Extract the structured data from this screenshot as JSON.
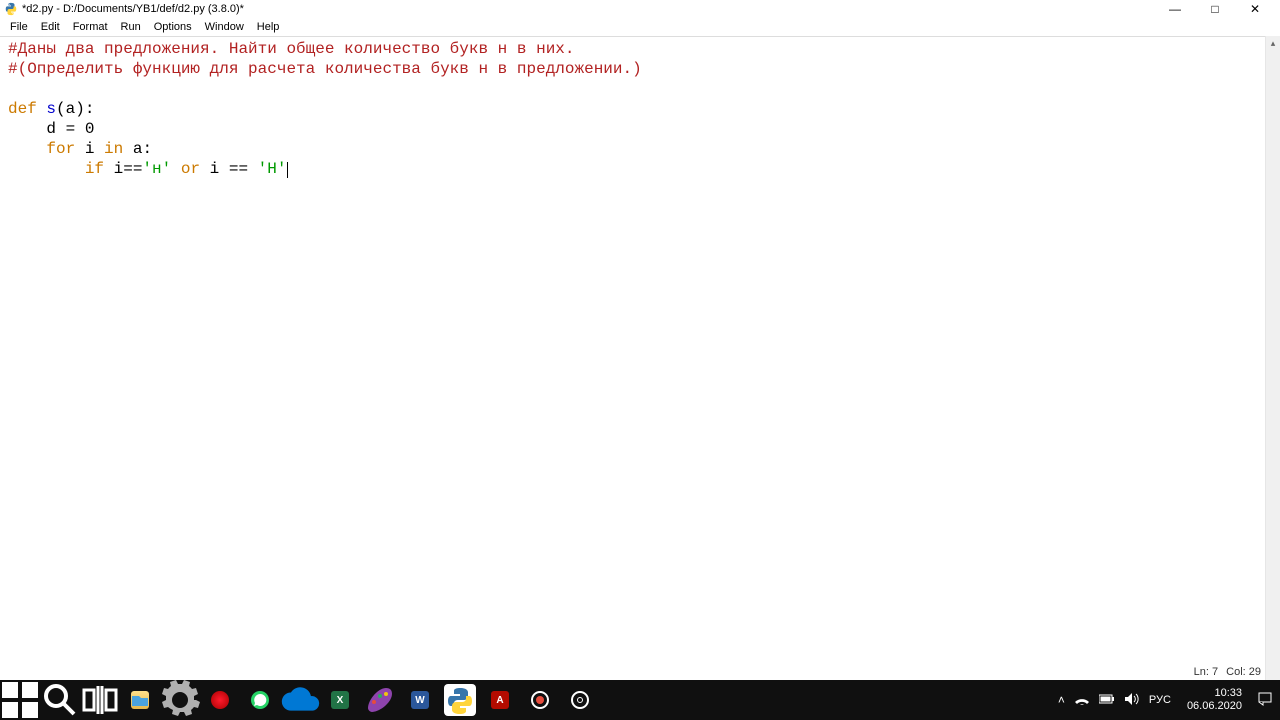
{
  "window": {
    "title": "*d2.py - D:/Documents/YB1/def/d2.py (3.8.0)*"
  },
  "menubar": {
    "items": [
      "File",
      "Edit",
      "Format",
      "Run",
      "Options",
      "Window",
      "Help"
    ]
  },
  "code": {
    "l1": "#Даны два предложения. Найти общее количество букв н в них.",
    "l2": "#(Определить функцию для расчета количества букв н в предложении.)",
    "l3": "",
    "l4_def": "def",
    "l4_name": " s",
    "l4_rest": "(a):",
    "l5": "    d = 0",
    "l6_ind": "    ",
    "l6_for": "for",
    "l6_i": " i ",
    "l6_in": "in",
    "l6_a": " a:",
    "l7_ind": "        ",
    "l7_if": "if",
    "l7_a": " i==",
    "l7_s1": "'н'",
    "l7_b": " ",
    "l7_or": "or",
    "l7_c": " i == ",
    "l7_s2": "'Н'"
  },
  "status": {
    "line": "Ln: 7",
    "col": "Col: 29"
  },
  "tray": {
    "lang": "РУС",
    "time": "10:33",
    "date": "06.06.2020"
  }
}
